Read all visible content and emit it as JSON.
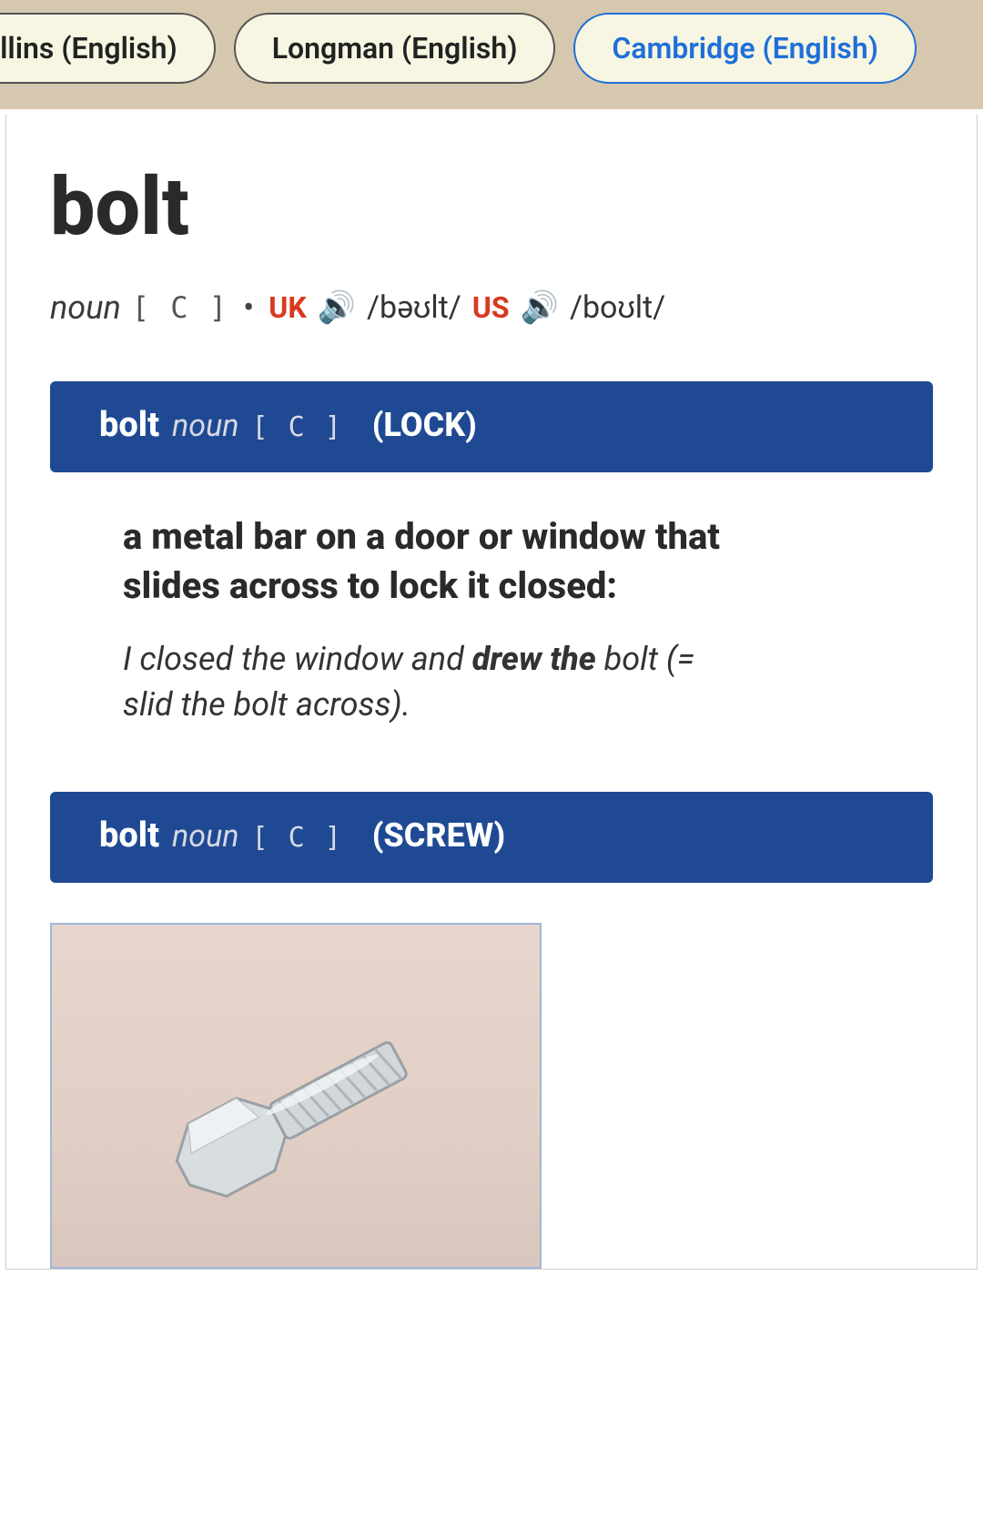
{
  "tabs": [
    {
      "label": "ollins (English)",
      "active": false
    },
    {
      "label": "Longman (English)",
      "active": false
    },
    {
      "label": "Cambridge (English)",
      "active": true
    }
  ],
  "entry": {
    "headword": "bolt",
    "pos": "noun",
    "gram": "[ C ]",
    "dot": "•",
    "uk": {
      "label": "UK",
      "ipa": "/bəʊlt/"
    },
    "us": {
      "label": "US",
      "ipa": "/boʊlt/"
    }
  },
  "senses": [
    {
      "word": "bolt",
      "pos": "noun",
      "gram": "[ C ]",
      "tag": "(LOCK)",
      "definition": "a metal bar on a door or window that slides across to lock it closed:",
      "example_pre": "I closed the window and ",
      "example_bold": "drew the",
      "example_post": " bolt (= slid the bolt across)."
    },
    {
      "word": "bolt",
      "pos": "noun",
      "gram": "[ C ]",
      "tag": "(SCREW)"
    }
  ]
}
